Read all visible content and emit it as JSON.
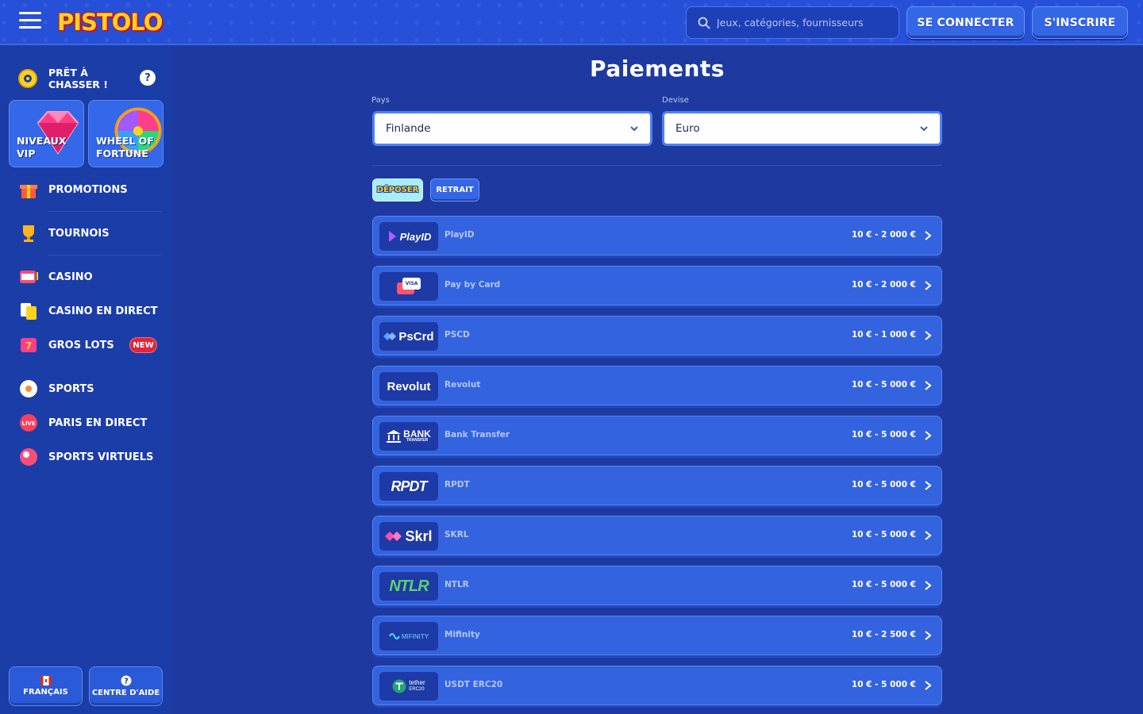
{
  "header": {
    "logo_text": "PISTOLO",
    "search_placeholder": "Jeux, catégories, fournisseurs",
    "login_label": "SE CONNECTER",
    "signup_label": "S'INSCRIRE"
  },
  "sidebar": {
    "ready_label": "PRÊT À CHASSER !",
    "help_mark": "?",
    "tiles": [
      {
        "label": "NIVEAUX VIP",
        "icon": "diamond-icon"
      },
      {
        "label": "WHEEL OF FORTUNE",
        "icon": "wheel-icon"
      }
    ],
    "items": [
      {
        "label": "PROMOTIONS",
        "icon": "gift-icon"
      },
      {
        "label": "TOURNOIS",
        "icon": "trophy-icon"
      },
      {
        "label": "CASINO",
        "icon": "slot-icon"
      },
      {
        "label": "CASINO EN DIRECT",
        "icon": "cards-icon"
      },
      {
        "label": "GROS LOTS",
        "icon": "jackpot-icon",
        "badge": "NEW"
      },
      {
        "label": "SPORTS",
        "icon": "ball-icon"
      },
      {
        "label": "PARIS EN DIRECT",
        "icon": "live-icon"
      },
      {
        "label": "SPORTS VIRTUELS",
        "icon": "virtual-sports-icon"
      }
    ],
    "footer": {
      "language_label": "FRANÇAIS",
      "help_label": "CENTRE D'AIDE"
    }
  },
  "main": {
    "title": "Paiements",
    "country": {
      "label": "Pays",
      "value": "Finlande"
    },
    "currency": {
      "label": "Devise",
      "value": "Euro"
    },
    "tabs": {
      "deposit": "DÉPOSER",
      "withdraw": "RETRAIT"
    },
    "methods": [
      {
        "logo": "PlayID",
        "name": "PlayID",
        "range": "10 € - 2 000 €"
      },
      {
        "logo": "VISA",
        "name": "Pay by Card",
        "range": "10 € - 2 000 €"
      },
      {
        "logo": "PsCrd",
        "name": "PSCD",
        "range": "10 € - 1 000 €"
      },
      {
        "logo": "Revolut",
        "name": "Revolut",
        "range": "10 € - 5 000 €"
      },
      {
        "logo": "BANK",
        "logo_sub": "TRANSFER",
        "name": "Bank Transfer",
        "range": "10 € - 5 000 €"
      },
      {
        "logo": "RPDT",
        "name": "RPDT",
        "range": "10 € - 5 000 €"
      },
      {
        "logo": "Skrl",
        "name": "SKRL",
        "range": "10 € - 5 000 €"
      },
      {
        "logo": "NTLR",
        "name": "NTLR",
        "range": "10 € - 5 000 €"
      },
      {
        "logo": "MIFINITY",
        "name": "Mifinity",
        "range": "10 € - 2 500 €"
      },
      {
        "logo": "tether",
        "logo_sub": "ERC20",
        "name": "USDT ERC20",
        "range": "10 € - 5 000 €"
      }
    ]
  },
  "colors": {
    "background": "#1e3aa0",
    "header": "#2650d8",
    "sidebar": "#1b3da8",
    "row": "#3463e0",
    "accent_yellow": "#ffd21f",
    "badge_red": "#e0243a"
  }
}
